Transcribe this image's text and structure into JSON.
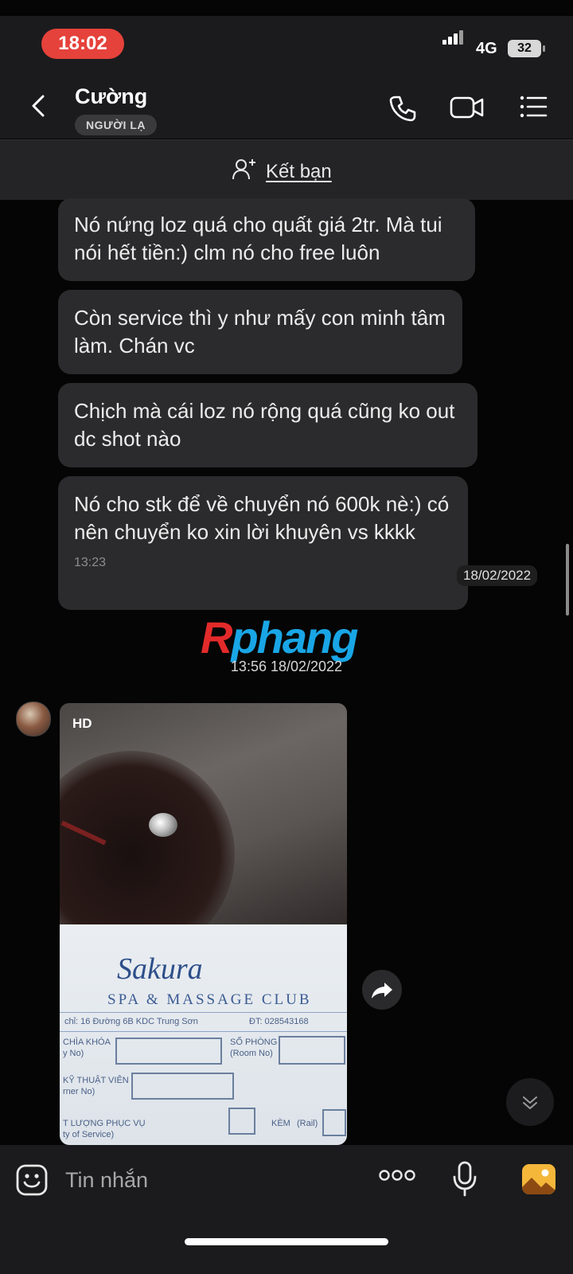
{
  "status_bar": {
    "time": "18:02",
    "network": "4G",
    "battery": "32"
  },
  "header": {
    "contact_name": "Cường",
    "stranger_badge": "NGƯỜI LẠ"
  },
  "friend_bar": {
    "label": "Kết bạn"
  },
  "messages": [
    {
      "text": "Nó nứng loz quá cho quất giá 2tr. Mà tui nói hết tiền:) clm nó cho free luôn"
    },
    {
      "text": "Còn service thì y như mấy con minh tâm làm. Chán vc"
    },
    {
      "text": "Chịch mà cái loz nó rộng quá cũng ko out dc shot nào"
    },
    {
      "text": "Nó cho stk để về chuyển nó 600k nè:) có nên chuyển ko xin lời khuyên vs kkkk",
      "time": "13:23"
    }
  ],
  "date_chip": "18/02/2022",
  "watermark": {
    "r": "R",
    "rest": "phang"
  },
  "time_separator": "13:56 18/02/2022",
  "photo": {
    "quality": "HD",
    "brand": "Sakura",
    "club": "SPA & MASSAGE CLUB",
    "address": "chỉ: 16 Đường 6B KDC Trung Sơn",
    "phone": "ĐT: 028543168",
    "field_key": "CHÌA KHÓA",
    "field_key_sub": "y No)",
    "field_room": "SỐ PHÒNG",
    "field_room_sub": "(Room No)",
    "field_tech": "KỸ THUẬT VIÊN",
    "field_tech_sub": "rner No)",
    "field_service": "T LƯỢNG PHỤC VỤ",
    "field_service_sub": "ty of Service)",
    "field_kem": "KÈM",
    "field_rail": "(Rail)"
  },
  "input_bar": {
    "placeholder": "Tin nhắn"
  },
  "icons": [
    "back-icon",
    "phone-icon",
    "video-call-icon",
    "menu-list-icon",
    "add-friend-icon",
    "forward-icon",
    "chevron-down-icon",
    "emoji-icon",
    "more-dots-icon",
    "microphone-icon",
    "image-icon"
  ]
}
